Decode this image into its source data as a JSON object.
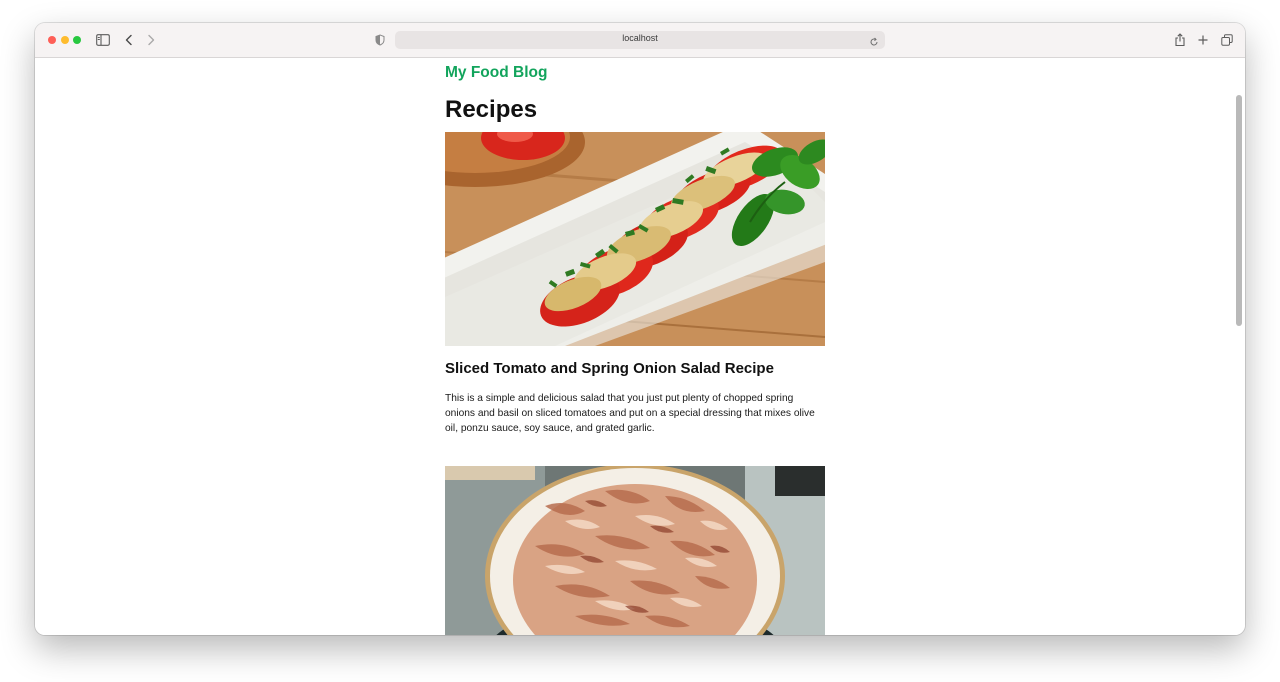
{
  "browser": {
    "url": "localhost",
    "colors": {
      "close": "#fe5f57",
      "minimize": "#febc2e",
      "zoom": "#28c840"
    }
  },
  "page": {
    "blog_title": "My Food Blog",
    "heading": "Recipes",
    "accent_color": "#12a45c"
  },
  "recipes": [
    {
      "title": "Sliced Tomato and Spring Onion Salad Recipe",
      "description": "This is a simple and delicious salad that you just put plenty of chopped spring onions and basil on sliced tomatoes and put on a special dressing that mixes olive oil, ponzu sauce, soy sauce, and grated garlic."
    },
    {
      "title": "",
      "description": ""
    }
  ]
}
